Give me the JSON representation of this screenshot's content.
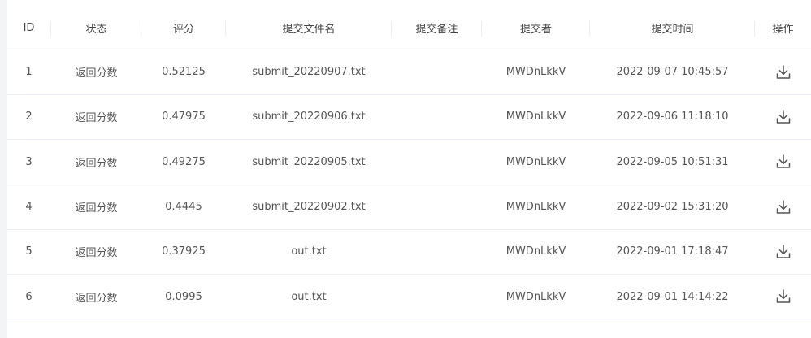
{
  "table": {
    "headers": [
      "ID",
      "状态",
      "评分",
      "提交文件名",
      "提交备注",
      "提交者",
      "提交时间",
      "操作"
    ],
    "rows": [
      {
        "id": "1",
        "status": "返回分数",
        "score": "0.52125",
        "filename": "submit_20220907.txt",
        "note": "",
        "submitter": "MWDnLkkV",
        "time": "2022-09-07 10:45:57",
        "action_icon": "download-icon"
      },
      {
        "id": "2",
        "status": "返回分数",
        "score": "0.47975",
        "filename": "submit_20220906.txt",
        "note": "",
        "submitter": "MWDnLkkV",
        "time": "2022-09-06 11:18:10",
        "action_icon": "download-icon"
      },
      {
        "id": "3",
        "status": "返回分数",
        "score": "0.49275",
        "filename": "submit_20220905.txt",
        "note": "",
        "submitter": "MWDnLkkV",
        "time": "2022-09-05 10:51:31",
        "action_icon": "download-icon"
      },
      {
        "id": "4",
        "status": "返回分数",
        "score": "0.4445",
        "filename": "submit_20220902.txt",
        "note": "",
        "submitter": "MWDnLkkV",
        "time": "2022-09-02 15:31:20",
        "action_icon": "download-icon"
      },
      {
        "id": "5",
        "status": "返回分数",
        "score": "0.37925",
        "filename": "out.txt",
        "note": "",
        "submitter": "MWDnLkkV",
        "time": "2022-09-01 17:18:47",
        "action_icon": "download-icon"
      },
      {
        "id": "6",
        "status": "返回分数",
        "score": "0.0995",
        "filename": "out.txt",
        "note": "",
        "submitter": "MWDnLkkV",
        "time": "2022-09-01 14:14:22",
        "action_icon": "download-icon"
      }
    ]
  }
}
